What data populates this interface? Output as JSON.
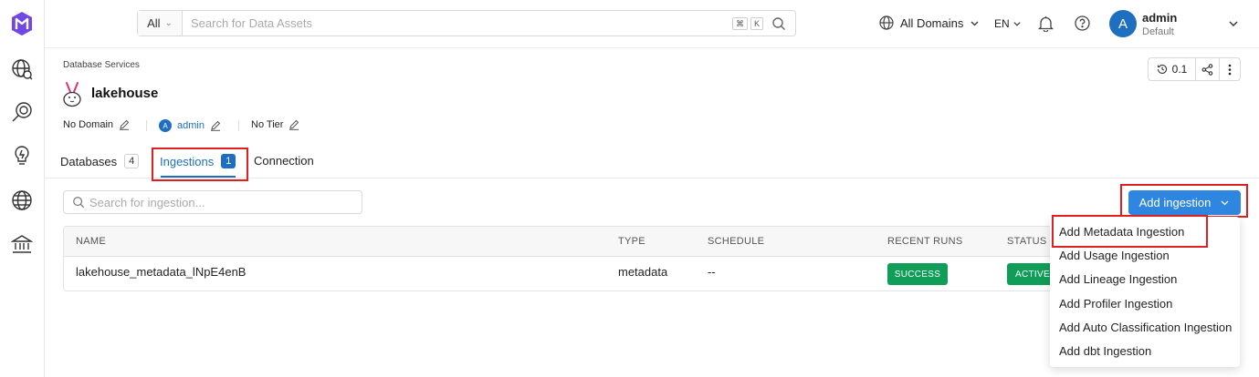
{
  "topbar": {
    "scope_label": "All",
    "search_placeholder": "Search for Data Assets",
    "kbd_cmd": "⌘",
    "kbd_k": "K",
    "domains_label": "All Domains",
    "language": "EN",
    "avatar_letter": "A",
    "user_name": "admin",
    "user_role": "Default"
  },
  "page": {
    "breadcrumb": "Database Services",
    "service_name": "lakehouse",
    "domain_label": "No Domain",
    "owner_avatar": "A",
    "owner_name": "admin",
    "tier_label": "No Tier",
    "version": "0.1"
  },
  "tabs": [
    {
      "label": "Databases",
      "count": "4"
    },
    {
      "label": "Ingestions",
      "count": "1"
    },
    {
      "label": "Connection"
    }
  ],
  "ingestions": {
    "search_placeholder": "Search for ingestion...",
    "add_button_label": "Add ingestion",
    "columns": [
      "NAME",
      "TYPE",
      "SCHEDULE",
      "RECENT RUNS",
      "STATUS"
    ],
    "rows": [
      {
        "name": "lakehouse_metadata_lNpE4enB",
        "type": "metadata",
        "schedule": "--",
        "recent_run": "SUCCESS",
        "status": "ACTIVE"
      }
    ]
  },
  "add_menu": {
    "items": [
      "Add Metadata Ingestion",
      "Add Usage Ingestion",
      "Add Lineage Ingestion",
      "Add Profiler Ingestion",
      "Add Auto Classification Ingestion",
      "Add dbt Ingestion"
    ]
  },
  "colors": {
    "primary": "#2f86e0",
    "link": "#1e6fbf",
    "success": "#0f9d58",
    "highlight": "#e02020"
  }
}
